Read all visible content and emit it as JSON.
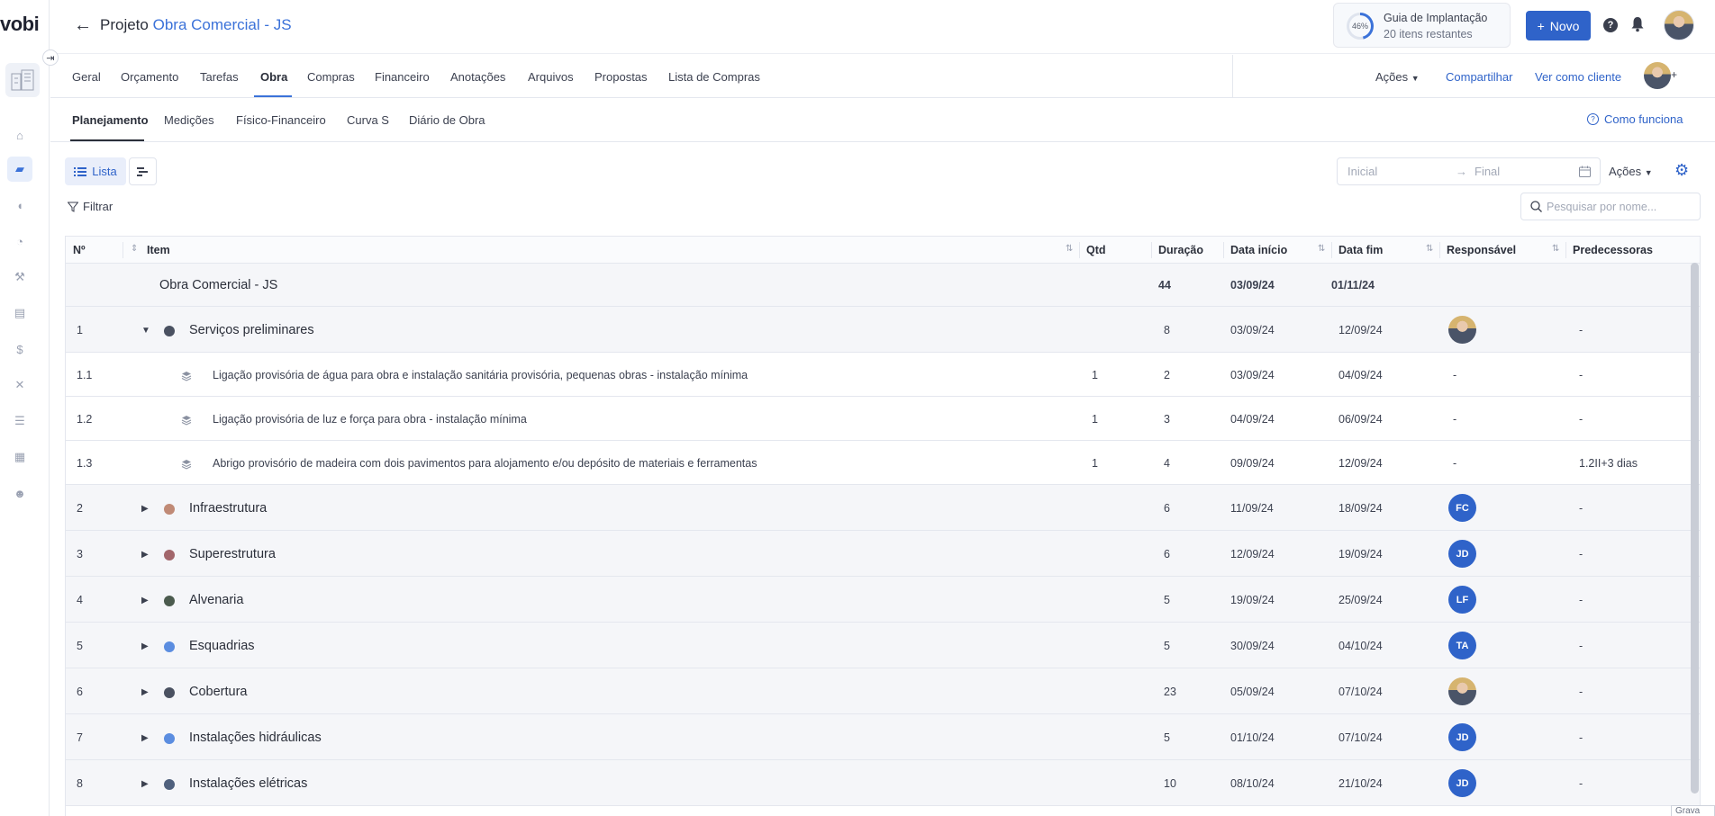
{
  "app": {
    "logo": "vobi"
  },
  "header": {
    "title_prefix": "Projeto",
    "title_name": "Obra Comercial - JS",
    "guide": {
      "percent": "46%",
      "title": "Guia de Implantação",
      "subtitle": "20 itens restantes",
      "progress": 0.46
    },
    "new_button": "Novo",
    "help_label": "?"
  },
  "main_tabs": [
    "Geral",
    "Orçamento",
    "Tarefas",
    "Obra",
    "Compras",
    "Financeiro",
    "Anotações",
    "Arquivos",
    "Propostas",
    "Lista de Compras"
  ],
  "main_tabs_active": "Obra",
  "header_actions": {
    "acoes": "Ações",
    "share": "Compartilhar",
    "view_as_client": "Ver como cliente"
  },
  "sub_tabs": [
    "Planejamento",
    "Medições",
    "Físico-Financeiro",
    "Curva S",
    "Diário de Obra"
  ],
  "sub_tabs_active": "Planejamento",
  "how_it_works": "Como funciona",
  "toolbar": {
    "list_label": "Lista",
    "filter_label": "Filtrar",
    "date_start_placeholder": "Inicial",
    "date_end_placeholder": "Final",
    "actions_label": "Ações",
    "search_placeholder": "Pesquisar por nome..."
  },
  "table": {
    "columns": [
      "Nº",
      "Item",
      "Qtd",
      "Duração",
      "Data início",
      "Data fim",
      "Responsável",
      "Predecessoras"
    ],
    "summary": {
      "name": "Obra Comercial - JS",
      "duration": "44",
      "start": "03/09/24",
      "end": "01/11/24"
    },
    "rows": [
      {
        "num": "1",
        "name": "Serviços preliminares",
        "qty": "",
        "duration": "8",
        "start": "03/09/24",
        "end": "12/09/24",
        "resp": "photo",
        "pred": "-",
        "color": "#4a5161",
        "expanded": true
      },
      {
        "num": "1.1",
        "name": "Ligação provisória de água para obra e instalação sanitária provisória, pequenas obras - instalação mínima",
        "qty": "1",
        "duration": "2",
        "start": "03/09/24",
        "end": "04/09/24",
        "resp": "-",
        "pred": "-",
        "child": true
      },
      {
        "num": "1.2",
        "name": "Ligação provisória de luz e força para obra - instalação mínima",
        "qty": "1",
        "duration": "3",
        "start": "04/09/24",
        "end": "06/09/24",
        "resp": "-",
        "pred": "-",
        "child": true
      },
      {
        "num": "1.3",
        "name": "Abrigo provisório de madeira com dois pavimentos para alojamento e/ou depósito de materiais e ferramentas",
        "qty": "1",
        "duration": "4",
        "start": "09/09/24",
        "end": "12/09/24",
        "resp": "-",
        "pred": "1.2II+3 dias",
        "child": true
      },
      {
        "num": "2",
        "name": "Infraestrutura",
        "qty": "",
        "duration": "6",
        "start": "11/09/24",
        "end": "18/09/24",
        "resp": "FC",
        "pred": "-",
        "color": "#c08a76"
      },
      {
        "num": "3",
        "name": "Superestrutura",
        "qty": "",
        "duration": "6",
        "start": "12/09/24",
        "end": "19/09/24",
        "resp": "JD",
        "pred": "-",
        "color": "#a2666b"
      },
      {
        "num": "4",
        "name": "Alvenaria",
        "qty": "",
        "duration": "5",
        "start": "19/09/24",
        "end": "25/09/24",
        "resp": "LF",
        "pred": "-",
        "color": "#4b5b4e"
      },
      {
        "num": "5",
        "name": "Esquadrias",
        "qty": "",
        "duration": "5",
        "start": "30/09/24",
        "end": "04/10/24",
        "resp": "TA",
        "pred": "-",
        "color": "#5b8de0"
      },
      {
        "num": "6",
        "name": "Cobertura",
        "qty": "",
        "duration": "23",
        "start": "05/09/24",
        "end": "07/10/24",
        "resp": "photo",
        "pred": "-",
        "color": "#4a5161"
      },
      {
        "num": "7",
        "name": "Instalações hidráulicas",
        "qty": "",
        "duration": "5",
        "start": "01/10/24",
        "end": "07/10/24",
        "resp": "JD",
        "pred": "-",
        "color": "#5b8de0"
      },
      {
        "num": "8",
        "name": "Instalações elétricas",
        "qty": "",
        "duration": "10",
        "start": "08/10/24",
        "end": "21/10/24",
        "resp": "JD",
        "pred": "-",
        "color": "#4f607d"
      }
    ]
  },
  "tooltip": "Grava",
  "colors": {
    "accent": "#2f63c9",
    "text": "#2b2f3a"
  },
  "rail_icons": [
    "home-icon",
    "folder-icon",
    "handshake-icon",
    "gauge-icon",
    "worker-icon",
    "coins-icon",
    "dollar-icon",
    "tools-icon",
    "list-icon",
    "apps-icon",
    "team-icon"
  ]
}
